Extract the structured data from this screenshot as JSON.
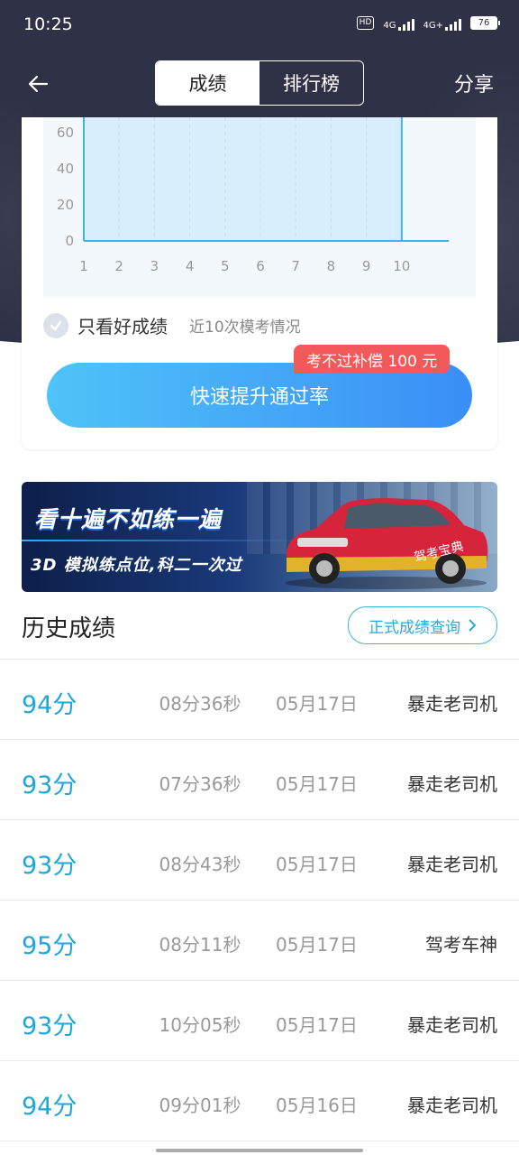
{
  "status_bar": {
    "time": "10:25",
    "hd": "HD",
    "net1": "4G",
    "net2": "4G+",
    "battery": "76"
  },
  "nav": {
    "tabs": [
      {
        "label": "成绩",
        "active": true
      },
      {
        "label": "排行榜",
        "active": false
      }
    ],
    "share": "分享"
  },
  "chart_data": {
    "type": "bar",
    "categories": [
      "1",
      "2",
      "3",
      "4",
      "5",
      "6",
      "7",
      "8",
      "9",
      "10"
    ],
    "visible_y_ticks": [
      0,
      20,
      40,
      60
    ],
    "ylim": [
      0,
      60
    ],
    "values": [
      100,
      100,
      100,
      100,
      100,
      100,
      100,
      100,
      100,
      100
    ],
    "grid": "dashed vertical"
  },
  "filter": {
    "label": "只看好成绩",
    "sub": "近10次模考情况"
  },
  "promo": {
    "tag": "考不过补偿 100 元",
    "button": "快速提升通过率"
  },
  "banner": {
    "title": "看十遍不如练一遍",
    "subtitle": "3D 模拟练点位,科二一次过",
    "car_text": "驾考宝典"
  },
  "history": {
    "title": "历史成绩",
    "query_button": "正式成绩查询",
    "rows": [
      {
        "score": "94分",
        "duration": "08分36秒",
        "date": "05月17日",
        "user": "暴走老司机"
      },
      {
        "score": "93分",
        "duration": "07分36秒",
        "date": "05月17日",
        "user": "暴走老司机"
      },
      {
        "score": "93分",
        "duration": "08分43秒",
        "date": "05月17日",
        "user": "暴走老司机"
      },
      {
        "score": "95分",
        "duration": "08分11秒",
        "date": "05月17日",
        "user": "驾考车神"
      },
      {
        "score": "93分",
        "duration": "10分05秒",
        "date": "05月17日",
        "user": "暴走老司机"
      },
      {
        "score": "94分",
        "duration": "09分01秒",
        "date": "05月16日",
        "user": "暴走老司机"
      }
    ]
  },
  "colors": {
    "header_bg": "#2f3146",
    "accent": "#1ea7d8",
    "promo": "#f25a5a"
  }
}
